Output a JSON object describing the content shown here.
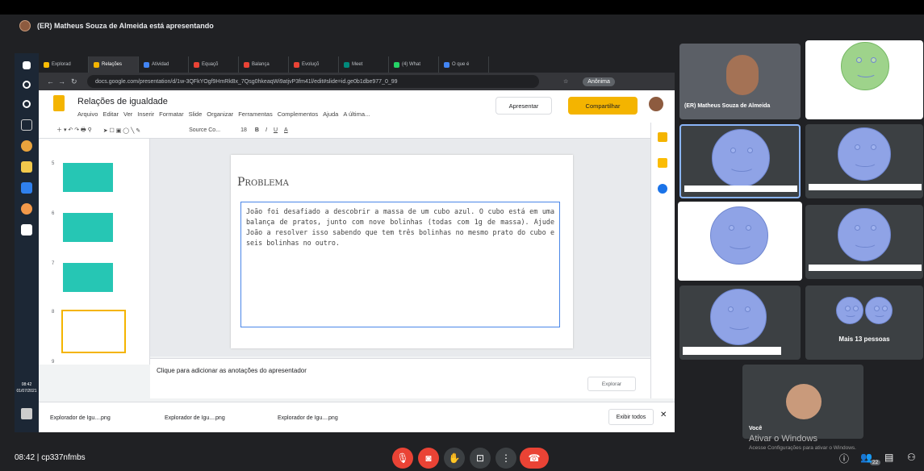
{
  "presenter_banner": "(ER) Matheus Souza de Almeida está apresentando",
  "browser": {
    "tabs": [
      "Explorad",
      "Relações",
      "Atividad",
      "Equaçõ",
      "Balança",
      "Evoluçõ",
      "Meet",
      "(4) What",
      "O que é"
    ],
    "url": "docs.google.com/presentation/d/1w-3QFkYOgf9HmRkBx_7Qsg0hkeaqWi9atjvP3fm41l/edit#slide=id.ge0b1dbe977_0_99",
    "profile": "Anônima"
  },
  "docs": {
    "title": "Relações de igualdade",
    "menu": [
      "Arquivo",
      "Editar",
      "Ver",
      "Inserir",
      "Formatar",
      "Slide",
      "Organizar",
      "Ferramentas",
      "Complementos",
      "Ajuda",
      "A última..."
    ],
    "present_label": "Apresentar",
    "share_label": "Compartilhar",
    "font": "Source Co...",
    "font_size": "18"
  },
  "slide": {
    "title": "Problema",
    "body": "João foi desafiado a descobrir a massa de um cubo azul. O cubo está em uma balança de pratos, junto com nove bolinhas (todas com 1g de massa). Ajude João a resolver isso sabendo que tem três bolinhas no mesmo prato do cubo e seis bolinhas no outro."
  },
  "thumbs": [
    "5",
    "6",
    "7",
    "8",
    "9"
  ],
  "notes_placeholder": "Clique para adicionar as anotações do apresentador",
  "explore_label": "Explorar",
  "downloads": [
    "Explorador de Igu....png",
    "Explorador de Igu....png",
    "Explorador de Igu....png"
  ],
  "show_all_label": "Exibir todos",
  "taskbar_time": "08:42",
  "taskbar_date": "01/07/2021",
  "participants": {
    "presenter_name": "(ER) Matheus Souza de Almeida",
    "more_label": "Mais 13 pessoas",
    "self_label": "Você"
  },
  "meeting_time": "08:42",
  "meeting_code": "cp337nfmbs",
  "windows_activate": "Ativar o Windows",
  "windows_activate_sub": "Acesse Configurações para ativar o Windows.",
  "people_count": "22"
}
